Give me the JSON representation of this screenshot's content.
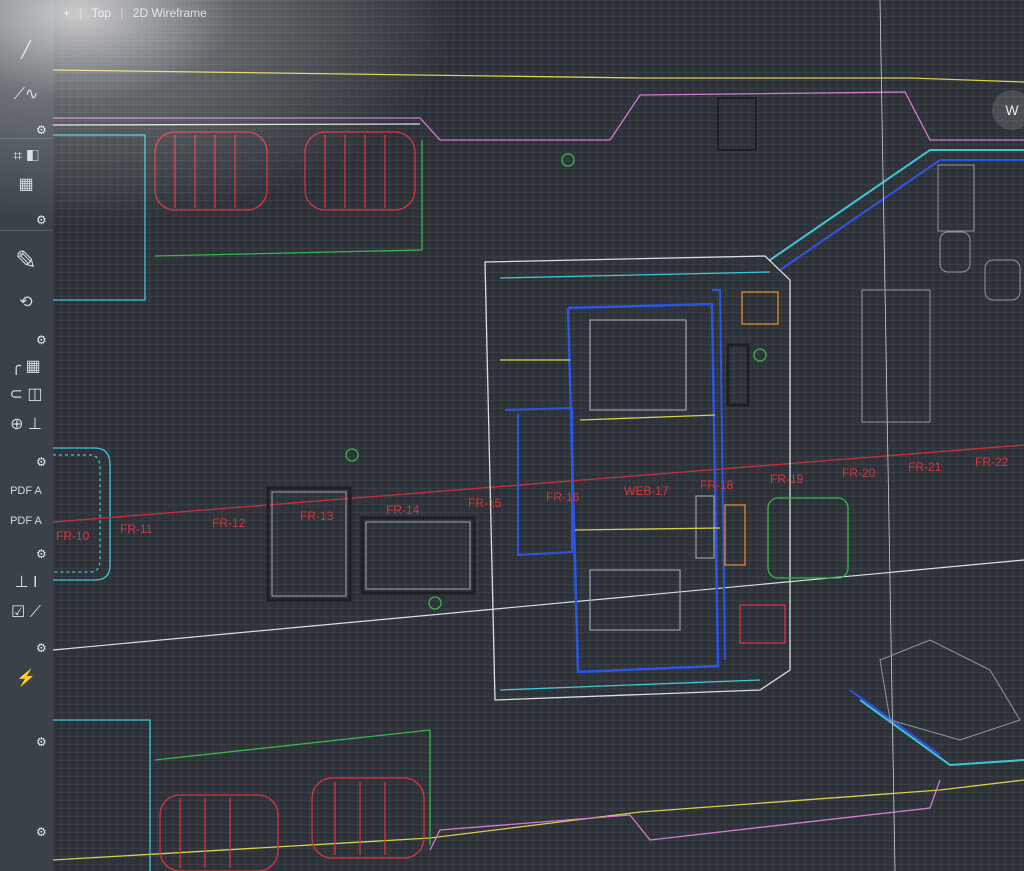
{
  "viewport": {
    "menu": "+",
    "view": "Top",
    "visual_style": "2D Wireframe"
  },
  "viewcube": {
    "label": "W"
  },
  "palette": {
    "tools": [
      {
        "icon": "line-icon"
      },
      {
        "icon": "polyline-icon"
      },
      {
        "icon": "crop-icon"
      },
      {
        "icon": "hatch-icon"
      },
      {
        "icon": "layer-edit-icon"
      },
      {
        "icon": "rotate-icon"
      },
      {
        "icon": "fillet-icon"
      },
      {
        "icon": "array-icon"
      },
      {
        "icon": "measure-icon"
      },
      {
        "icon": "pdf-import-icon"
      },
      {
        "icon": "pdf-text-icon"
      },
      {
        "icon": "dimension-icon"
      },
      {
        "icon": "check-icon"
      },
      {
        "icon": "lightning-icon"
      }
    ],
    "pdf_label": "PDF"
  },
  "frame_labels": [
    "FR-10",
    "FR-11",
    "FR-12",
    "FR-13",
    "FR-14",
    "FR-15",
    "FR-16",
    "WEB-17",
    "FR-18",
    "FR-19",
    "FR-20",
    "FR-21",
    "FR-22"
  ],
  "colors": {
    "frame_label": "#d8343b",
    "centerline": "#c8303a",
    "wall_cyan": "#3fc6d8",
    "wall_blue": "#2c55e6",
    "pink": "#d67ad0",
    "green": "#34b84a",
    "orange": "#e08a2b",
    "yellow": "#d8d04a"
  }
}
